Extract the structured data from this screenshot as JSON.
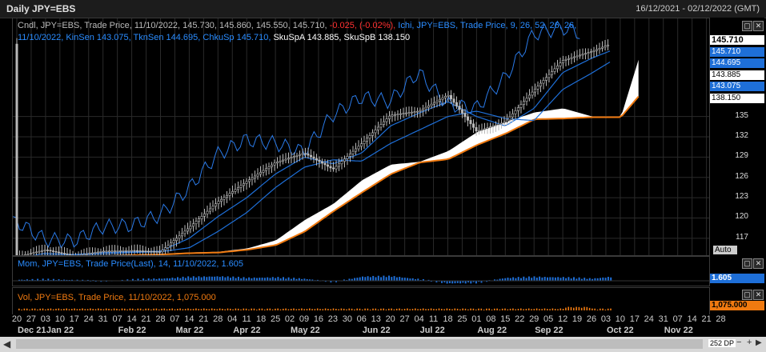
{
  "window": {
    "title": "Daily JPY=EBS",
    "range": "16/12/2021 - 02/12/2022 (GMT)"
  },
  "legend_main": {
    "cndl": "Cndl, JPY=EBS, Trade Price, 11/10/2022, 145.730, 145.860, 145.550, 145.710,",
    "cndl_chg": "-0.025, (-0.02%),",
    "ichi": "Ichi, JPY=EBS, Trade Price,  9, 26, 52, 26, 26,",
    "ichi2": "11/10/2022, KinSen 143.075, TknSen 144.695, ChkuSp 145.710,",
    "sku": "SkuSpA 143.885, SkuSpB 138.150"
  },
  "legend_mom": "Mom, JPY=EBS, Trade Price(Last),  14,  11/10/2022, 1.605",
  "legend_vol": "Vol, JPY=EBS, Trade Price,  11/10/2022, 1,075.000",
  "price_tags": [
    {
      "text": "145.710",
      "bg": "#ffffff",
      "fg": "#000000",
      "bold": true
    },
    {
      "text": "145.710",
      "bg": "#1e6fd8",
      "fg": "#ffffff"
    },
    {
      "text": "144.695",
      "bg": "#1e6fd8",
      "fg": "#ffffff"
    },
    {
      "text": "143.885",
      "bg": "#ffffff",
      "fg": "#000000"
    },
    {
      "text": "143.075",
      "bg": "#1e6fd8",
      "fg": "#ffffff"
    },
    {
      "text": "138.150",
      "bg": "#ffffff",
      "fg": "#000000"
    }
  ],
  "y_ticks": [
    "135",
    "132",
    "129",
    "126",
    "123",
    "120",
    "117"
  ],
  "auto_label": "Auto",
  "mom_tag": "1.605",
  "vol_tag": "1,075.000",
  "x_days": [
    "20",
    "27",
    "03",
    "10",
    "17",
    "24",
    "31",
    "07",
    "14",
    "21",
    "28",
    "07",
    "14",
    "21",
    "28",
    "04",
    "11",
    "18",
    "25",
    "02",
    "09",
    "16",
    "23",
    "30",
    "06",
    "13",
    "20",
    "27",
    "04",
    "11",
    "18",
    "25",
    "01",
    "08",
    "15",
    "22",
    "29",
    "05",
    "12",
    "19",
    "26",
    "03",
    "10",
    "17",
    "24",
    "31",
    "07",
    "14",
    "21",
    "28"
  ],
  "x_months": [
    {
      "label": "Dec 21",
      "day_index": 0
    },
    {
      "label": "Jan 22",
      "day_index": 2
    },
    {
      "label": "Feb 22",
      "day_index": 7
    },
    {
      "label": "Mar 22",
      "day_index": 11
    },
    {
      "label": "Apr 22",
      "day_index": 15
    },
    {
      "label": "May 22",
      "day_index": 19
    },
    {
      "label": "Jun 22",
      "day_index": 24
    },
    {
      "label": "Jul 22",
      "day_index": 28
    },
    {
      "label": "Aug 22",
      "day_index": 32
    },
    {
      "label": "Sep 22",
      "day_index": 36
    },
    {
      "label": "Oct 22",
      "day_index": 41
    },
    {
      "label": "Nov 22",
      "day_index": 45
    }
  ],
  "scroll_label": "252 DP",
  "colors": {
    "candle": "#b8b8b8",
    "tenkan": "#1e6fd8",
    "kijun": "#1e6fd8",
    "chikou": "#2a7ae8",
    "cloud": "#ffffff",
    "cloud_edge": "#f07a10",
    "mom": "#1e6fd8",
    "vol": "#f07a10",
    "grid": "#2a2a2a"
  },
  "chart_data": {
    "type": "line",
    "title": "Daily JPY=EBS",
    "ylim": [
      114.5,
      149.5
    ],
    "x": [
      "2021-12-20",
      "2022-01-03",
      "2022-01-17",
      "2022-01-31",
      "2022-02-14",
      "2022-02-28",
      "2022-03-14",
      "2022-03-28",
      "2022-04-11",
      "2022-04-25",
      "2022-05-09",
      "2022-05-23",
      "2022-06-06",
      "2022-06-20",
      "2022-07-04",
      "2022-07-18",
      "2022-08-01",
      "2022-08-15",
      "2022-08-29",
      "2022-09-12",
      "2022-09-26",
      "2022-10-11"
    ],
    "series": [
      {
        "name": "Cndl",
        "values": [
          114.3,
          115.3,
          114.4,
          115.1,
          115.2,
          115.0,
          118.6,
          122.4,
          125.4,
          128.2,
          129.6,
          127.2,
          131.0,
          135.2,
          135.8,
          138.2,
          132.8,
          134.2,
          138.9,
          143.3,
          144.6,
          145.71
        ]
      },
      {
        "name": "TknSen",
        "values": [
          114.0,
          114.8,
          114.6,
          114.9,
          115.0,
          115.1,
          117.0,
          120.2,
          123.0,
          126.5,
          129.0,
          128.0,
          129.6,
          133.6,
          135.5,
          137.2,
          135.0,
          133.6,
          136.2,
          141.5,
          143.6,
          144.695
        ]
      },
      {
        "name": "KinSen",
        "values": [
          113.8,
          114.5,
          114.5,
          114.7,
          114.9,
          115.0,
          115.6,
          118.0,
          120.8,
          124.5,
          127.5,
          128.6,
          128.4,
          131.0,
          133.0,
          135.0,
          135.8,
          134.7,
          134.4,
          139.0,
          141.4,
          143.075
        ]
      },
      {
        "name": "SkuSpA",
        "values": [
          114.2,
          114.3,
          114.5,
          114.6,
          114.7,
          114.9,
          115.0,
          115.5,
          116.7,
          119.7,
          122.1,
          125.6,
          127.9,
          128.3,
          129.9,
          132.7,
          134.2,
          135.6,
          136.2,
          135.0,
          134.9,
          143.885
        ]
      },
      {
        "name": "SkuSpB",
        "values": [
          114.0,
          114.1,
          114.3,
          114.5,
          114.6,
          114.8,
          114.9,
          115.3,
          116.0,
          118.0,
          121.0,
          123.8,
          126.5,
          128.2,
          128.7,
          130.8,
          132.5,
          134.6,
          134.7,
          134.9,
          134.9,
          138.15
        ]
      }
    ],
    "ichimoku_params": [
      9,
      26,
      52,
      26,
      26
    ],
    "last_close": 145.71,
    "momentum": {
      "period": 14,
      "last": 1.605,
      "series": [
        0.4,
        0.6,
        0.3,
        -0.2,
        0.5,
        0.9,
        1.6,
        1.8,
        1.2,
        1.4,
        0.8,
        -0.5,
        1.7,
        1.9,
        0.6,
        -1.1,
        -0.8,
        1.2,
        1.6,
        1.4,
        0.9,
        1.605
      ]
    },
    "volume": {
      "last": 1075.0
    }
  }
}
